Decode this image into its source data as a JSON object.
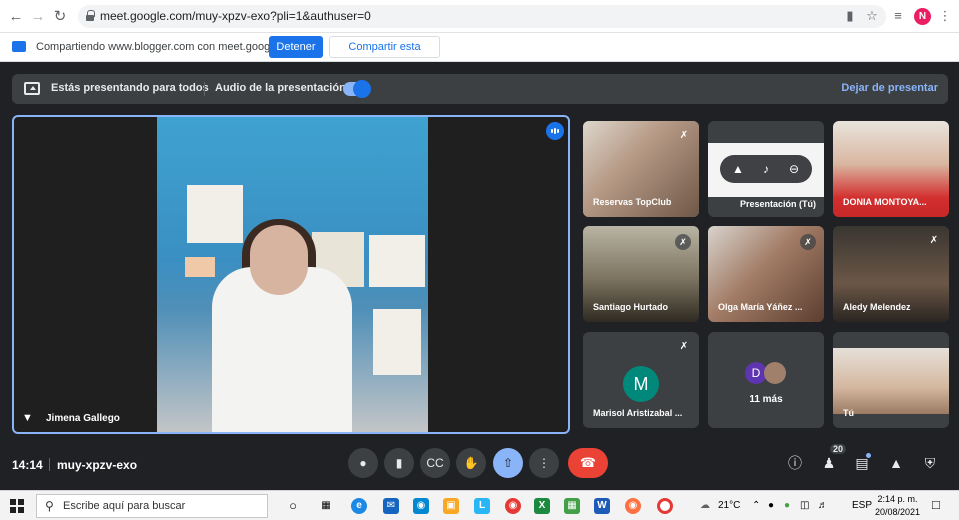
{
  "browser": {
    "url": "meet.google.com/muy-xpzv-exo?pli=1&authuser=0",
    "profile_initial": "N"
  },
  "share_bar": {
    "text": "Compartiendo www.blogger.com con meet.google.com",
    "stop_label": "Detener",
    "share_tab_label": "Compartir esta pestaña"
  },
  "present_bar": {
    "presenting_text": "Estás presentando para todos",
    "audio_text": "Audio de la presentación",
    "audio_on": true,
    "stop_label": "Dejar de presentar"
  },
  "main_tile": {
    "name": "Jimena Gallego"
  },
  "tiles": [
    {
      "name": "Reservas TopClub"
    },
    {
      "name": "Presentación (Tú)"
    },
    {
      "name": "DONIA MONTOYA..."
    },
    {
      "name": "Santiago Hurtado"
    },
    {
      "name": "Olga María Yáñez ..."
    },
    {
      "name": "Aledy Melendez"
    },
    {
      "name": "Marisol Aristizabal ...",
      "initial": "M"
    },
    {
      "more": "11 más",
      "initial": "D"
    },
    {
      "name": "Tú"
    }
  ],
  "bottom": {
    "time": "14:14",
    "meeting_code": "muy-xpzv-exo",
    "participant_count": "20"
  },
  "taskbar": {
    "search_placeholder": "Escribe aquí para buscar",
    "temperature": "21°C",
    "language": "ESP",
    "time": "2:14 p. m.",
    "date": "20/08/2021"
  },
  "colors": {
    "meet_bg": "#202124",
    "accent": "#8ab4f8",
    "primary_blue": "#1a73e8",
    "hangup_red": "#ea4335",
    "tile_bg": "#3c4043"
  }
}
